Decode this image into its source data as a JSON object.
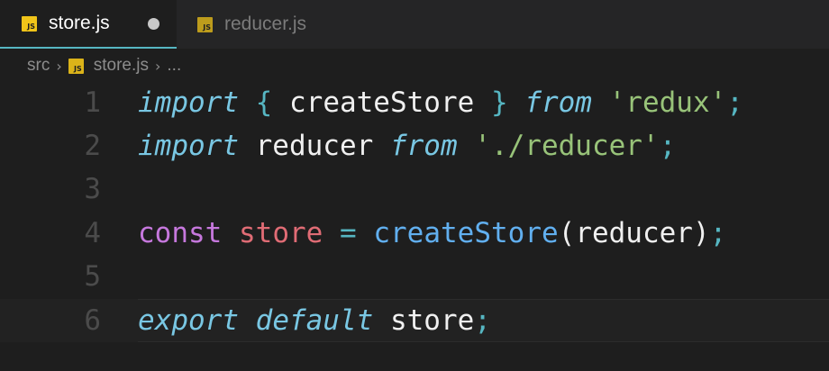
{
  "tabs": [
    {
      "label": "store.js",
      "icon": "js-file-icon",
      "badge": "JS",
      "active": true,
      "dirty": true
    },
    {
      "label": "reducer.js",
      "icon": "js-file-icon",
      "badge": "JS",
      "active": false
    }
  ],
  "breadcrumb": {
    "folder": "src",
    "file": "store.js",
    "file_badge": "JS",
    "more": "..."
  },
  "editor": {
    "lines": [
      {
        "number": "1",
        "tokens": {
          "t1": "import",
          "t2": " ",
          "t3": "{",
          "t4": " createStore ",
          "t5": "}",
          "t6": " ",
          "t7": "from",
          "t8": " ",
          "t9": "'redux'",
          "t10": ";"
        }
      },
      {
        "number": "2",
        "tokens": {
          "t1": "import",
          "t2": " reducer ",
          "t3": "from",
          "t4": " ",
          "t5": "'./reducer'",
          "t6": ";"
        }
      },
      {
        "number": "3"
      },
      {
        "number": "4",
        "tokens": {
          "t1": "const",
          "t2": " ",
          "t3": "store",
          "t4": " ",
          "t5": "=",
          "t6": " ",
          "t7": "createStore",
          "t8": "(reducer)",
          "t9": ";"
        }
      },
      {
        "number": "5"
      },
      {
        "number": "6",
        "tokens": {
          "t1": "export",
          "t2": " ",
          "t3": "default",
          "t4": " store",
          "t5": ";"
        }
      }
    ]
  },
  "colors": {
    "background": "#1e1e1e",
    "keyword_italic": "#79c7e3",
    "keyword_const": "#c678dd",
    "variable": "#e06c75",
    "function": "#61afef",
    "string": "#98c379",
    "punctuation": "#56b6c2",
    "active_tab_border": "#56b6c2",
    "js_badge": "#f0c419"
  }
}
